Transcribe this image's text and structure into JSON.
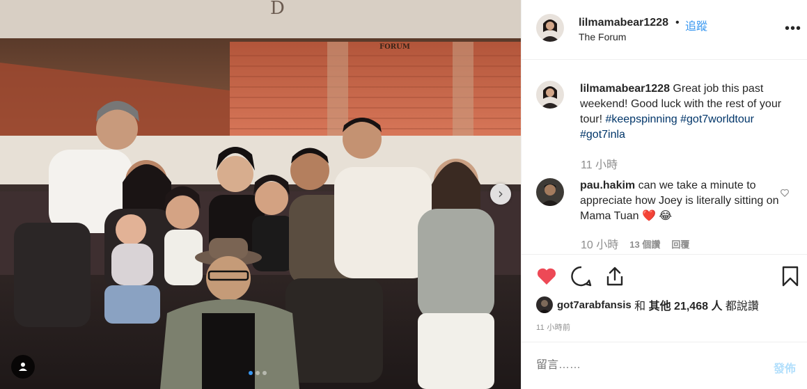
{
  "post": {
    "author": "lilmamabear1228",
    "separator": "•",
    "follow_label": "追蹤",
    "location": "The Forum",
    "more_icon": "more-options-icon"
  },
  "photo": {
    "carousel_total": 3,
    "carousel_active": 1,
    "next_icon": "chevron-right-icon",
    "tag_icon": "user-tag-icon",
    "next_glyph": "›"
  },
  "caption": {
    "username": "lilmamabear1228",
    "text": " Great job this past weekend! Good luck with the rest of your tour! ",
    "hashtags": [
      "#keepspinning",
      "#got7worldtour",
      "#got7inla"
    ],
    "time": "11 小時"
  },
  "comments": [
    {
      "username": "pau.hakim",
      "text": " can we take a minute to appreciate how Joey is literally sitting on Mama Tuan ",
      "emoji": "❤️",
      "emoji2": "😂",
      "time": "10 小時",
      "likes": "13 個讚",
      "reply_label": "回覆"
    }
  ],
  "actions": {
    "like_icon": "heart-filled-icon",
    "comment_icon": "comment-icon",
    "share_icon": "share-icon",
    "save_icon": "bookmark-icon",
    "like_color": "#ed4956"
  },
  "likes": {
    "username": "got7arabfansis",
    "and": " 和 ",
    "others": "其他 21,468 人",
    "suffix": " 都說讚"
  },
  "timestamp": "11 小時前",
  "add_comment": {
    "placeholder": "留言……",
    "post_label": "發佈"
  }
}
